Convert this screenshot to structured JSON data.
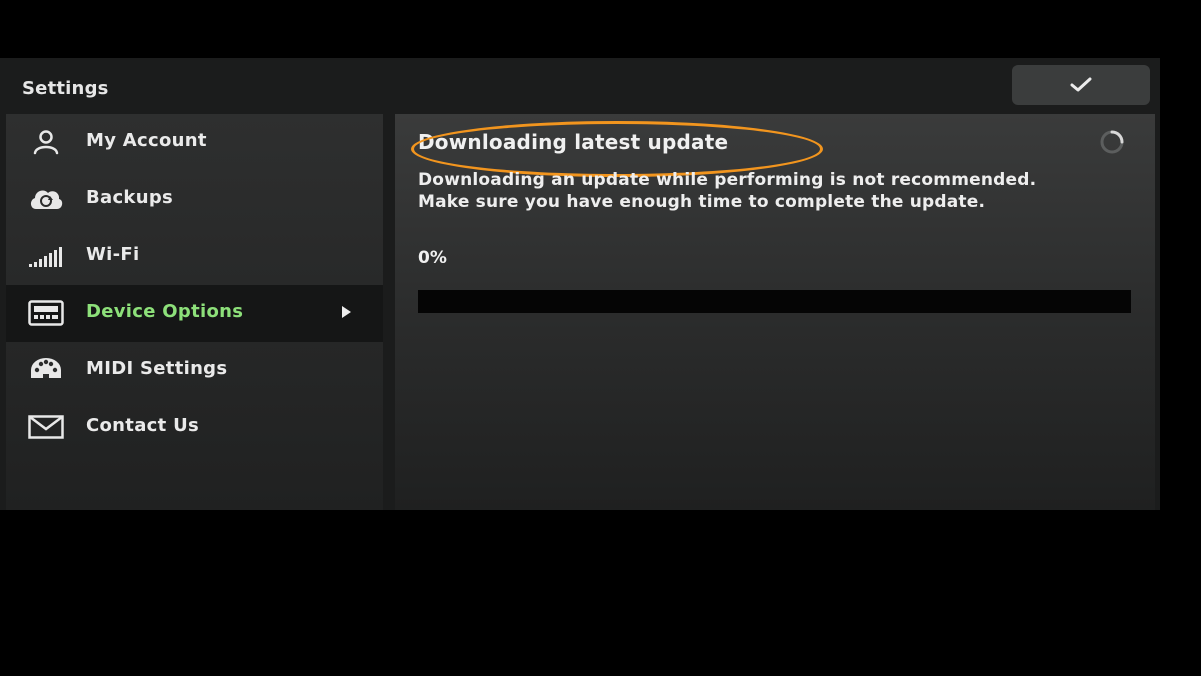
{
  "header": {
    "title": "Settings",
    "confirm_icon": "checkmark-icon"
  },
  "sidebar": {
    "items": [
      {
        "label": "My Account",
        "icon": "user-icon",
        "active": false
      },
      {
        "label": "Backups",
        "icon": "cloud-sync-icon",
        "active": false
      },
      {
        "label": "Wi-Fi",
        "icon": "signal-bars-icon",
        "active": false
      },
      {
        "label": "Device Options",
        "icon": "device-icon",
        "active": true
      },
      {
        "label": "MIDI Settings",
        "icon": "midi-connector-icon",
        "active": false
      },
      {
        "label": "Contact Us",
        "icon": "envelope-icon",
        "active": false
      }
    ]
  },
  "update": {
    "heading": "Downloading latest update",
    "description": "Downloading an update while performing is not recommended. Make sure you have enough time to complete the update.",
    "progress_text": "0%",
    "progress_value": 0
  },
  "colors": {
    "active_label": "#8de07a",
    "highlight_ring": "#f2951e"
  }
}
